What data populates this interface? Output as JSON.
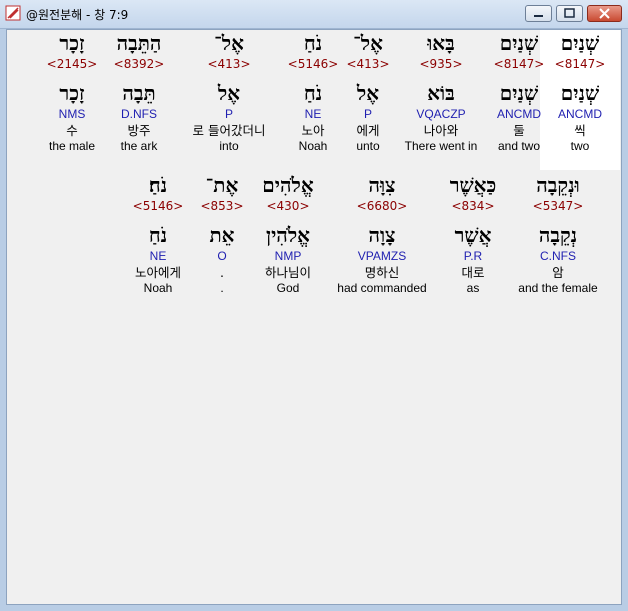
{
  "window": {
    "title": "@원전분해 - 창 7:9",
    "buttons": {
      "minimize_icon": "minimize-icon",
      "maximize_icon": "maximize-icon",
      "close_icon": "close-icon"
    }
  },
  "colors": {
    "strong": "#8b0000",
    "parse": "#1f1fb0",
    "selected_bg": "#ffffff"
  },
  "rows": [
    {
      "words": [
        {
          "hebrew": "שְׁנַיִם",
          "strong": "<8147>",
          "lemma": "שְׁנַיִם",
          "parse": "ANCMD",
          "korean": "씩",
          "english": "two",
          "selected": true
        },
        {
          "hebrew": "שְׁנַיִם",
          "strong": "<8147>",
          "lemma": "שְׁנַיִם",
          "parse": "ANCMD",
          "korean": "둘",
          "english": "and two"
        },
        {
          "hebrew": "בָּאוּ",
          "strong": "<935>",
          "lemma": "בּוֹא",
          "parse": "VQACZP",
          "korean": "나아와",
          "english": "There went in"
        },
        {
          "hebrew": "אֶל־",
          "strong": "<413>",
          "lemma": "אֶל",
          "parse": "P",
          "korean": "에게",
          "english": "unto"
        },
        {
          "hebrew": "נֹחַ",
          "strong": "<5146>",
          "lemma": "נֹחַ",
          "parse": "NE",
          "korean": "노아",
          "english": "Noah"
        },
        {
          "hebrew": "אֶל־",
          "strong": "<413>",
          "lemma": "אֶל",
          "parse": "P",
          "korean": "로 들어갔더니",
          "english": "into"
        },
        {
          "hebrew": "הַתֵּבָה",
          "strong": "<8392>",
          "lemma": "תֵּבָה",
          "parse": "D.NFS",
          "korean": "방주",
          "english": "the ark"
        },
        {
          "hebrew": "זָכָר",
          "strong": "<2145>",
          "lemma": "זָכָר",
          "parse": "NMS",
          "korean": "수",
          "english": "the male"
        }
      ]
    },
    {
      "words": [
        {
          "hebrew": "וּנְקֵבָה",
          "strong": "<5347>",
          "lemma": "נְקֵבָה",
          "parse": "C.NFS",
          "korean": "암",
          "english": "and the female"
        },
        {
          "hebrew": "כַּאֲשֶׁר",
          "strong": "<834>",
          "lemma": "אֲשֶׁר",
          "parse": "P.R",
          "korean": "대로",
          "english": "as"
        },
        {
          "hebrew": "צִוָּה",
          "strong": "<6680>",
          "lemma": "צָוָה",
          "parse": "VPAMZS",
          "korean": "명하신",
          "english": "had commanded"
        },
        {
          "hebrew": "אֱלֹהִים",
          "strong": "<430>",
          "lemma": "אֱלֹהִין",
          "parse": "NMP",
          "korean": "하나님이",
          "english": "God"
        },
        {
          "hebrew": "אֶת־",
          "strong": "<853>",
          "lemma": "אֵת",
          "parse": "O",
          "korean": ".",
          "english": "."
        },
        {
          "hebrew": "נֹחַ׃",
          "strong": "<5146>",
          "lemma": "נֹחַ",
          "parse": "NE",
          "korean": "노아에게",
          "english": "Noah"
        }
      ]
    }
  ]
}
